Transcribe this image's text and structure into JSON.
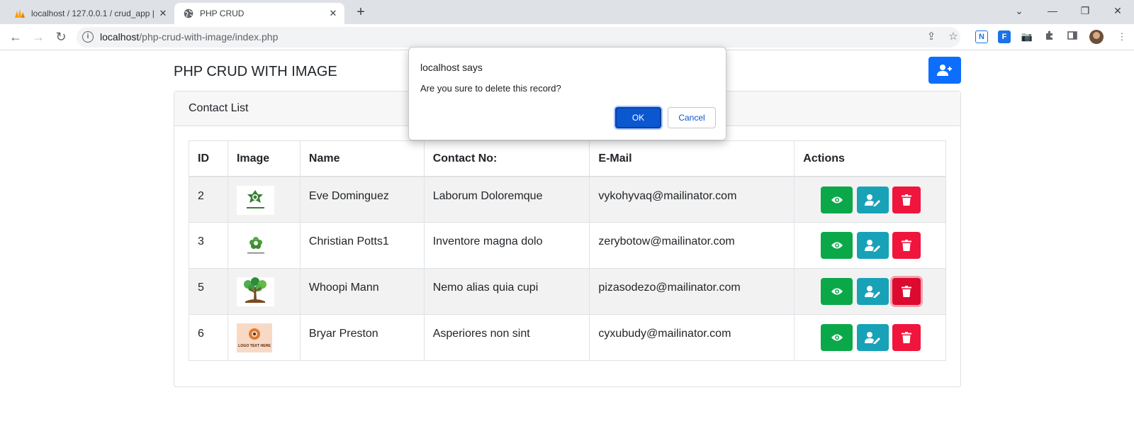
{
  "browser": {
    "tabs": [
      {
        "title": "localhost / 127.0.0.1 / crud_app |",
        "icon": "phpmyadmin-icon",
        "active": false
      },
      {
        "title": "PHP CRUD",
        "icon": "globe-icon",
        "active": true
      }
    ],
    "url_host": "localhost",
    "url_path": "/php-crud-with-image/index.php"
  },
  "page": {
    "title": "PHP CRUD WITH IMAGE",
    "card_header": "Contact List"
  },
  "table": {
    "headers": [
      "ID",
      "Image",
      "Name",
      "Contact No:",
      "E-Mail",
      "Actions"
    ],
    "rows": [
      {
        "id": "2",
        "image": "green-emblem-logo",
        "name": "Eve Dominguez",
        "contact": "Laborum Doloremque",
        "email": "vykohyvaq@mailinator.com"
      },
      {
        "id": "3",
        "image": "green-flower-logo",
        "name": "Christian Potts1",
        "contact": "Inventore magna dolo",
        "email": "zerybotow@mailinator.com"
      },
      {
        "id": "5",
        "image": "tree-logo",
        "name": "Whoopi Mann",
        "contact": "Nemo alias quia cupi",
        "email": "pizasodezo@mailinator.com"
      },
      {
        "id": "6",
        "image": "logo-text-here",
        "name": "Bryar Preston",
        "contact": "Asperiores non sint",
        "email": "cyxubudy@mailinator.com"
      }
    ],
    "thumb_text_row4": "LOGO TEXT HERE"
  },
  "dialog": {
    "title": "localhost says",
    "message": "Are you sure to delete this record?",
    "ok_label": "OK",
    "cancel_label": "Cancel"
  },
  "colors": {
    "primary": "#0d6efd",
    "view": "#0ba84a",
    "edit": "#17a2b8",
    "delete": "#f0153c"
  }
}
